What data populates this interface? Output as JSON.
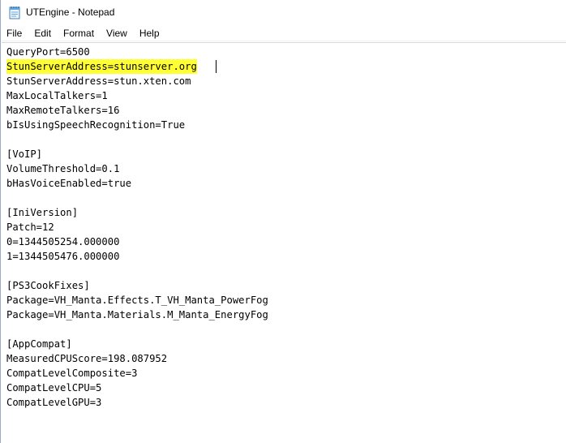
{
  "window": {
    "title": "UTEngine - Notepad",
    "icon": "notepad-icon"
  },
  "menu": {
    "items": [
      "File",
      "Edit",
      "Format",
      "View",
      "Help"
    ]
  },
  "editor": {
    "highlight_color": "#ffff33",
    "lines": [
      "QueryPort=6500",
      "StunServerAddress=stunserver.org",
      "StunServerAddress=stun.xten.com",
      "MaxLocalTalkers=1",
      "MaxRemoteTalkers=16",
      "bIsUsingSpeechRecognition=True",
      "",
      "[VoIP]",
      "VolumeThreshold=0.1",
      "bHasVoiceEnabled=true",
      "",
      "[IniVersion]",
      "Patch=12",
      "0=1344505254.000000",
      "1=1344505476.000000",
      "",
      "[PS3CookFixes]",
      "Package=VH_Manta.Effects.T_VH_Manta_PowerFog",
      "Package=VH_Manta.Materials.M_Manta_EnergyFog",
      "",
      "[AppCompat]",
      "MeasuredCPUScore=198.087952",
      "CompatLevelComposite=3",
      "CompatLevelCPU=5",
      "CompatLevelGPU=3"
    ]
  }
}
